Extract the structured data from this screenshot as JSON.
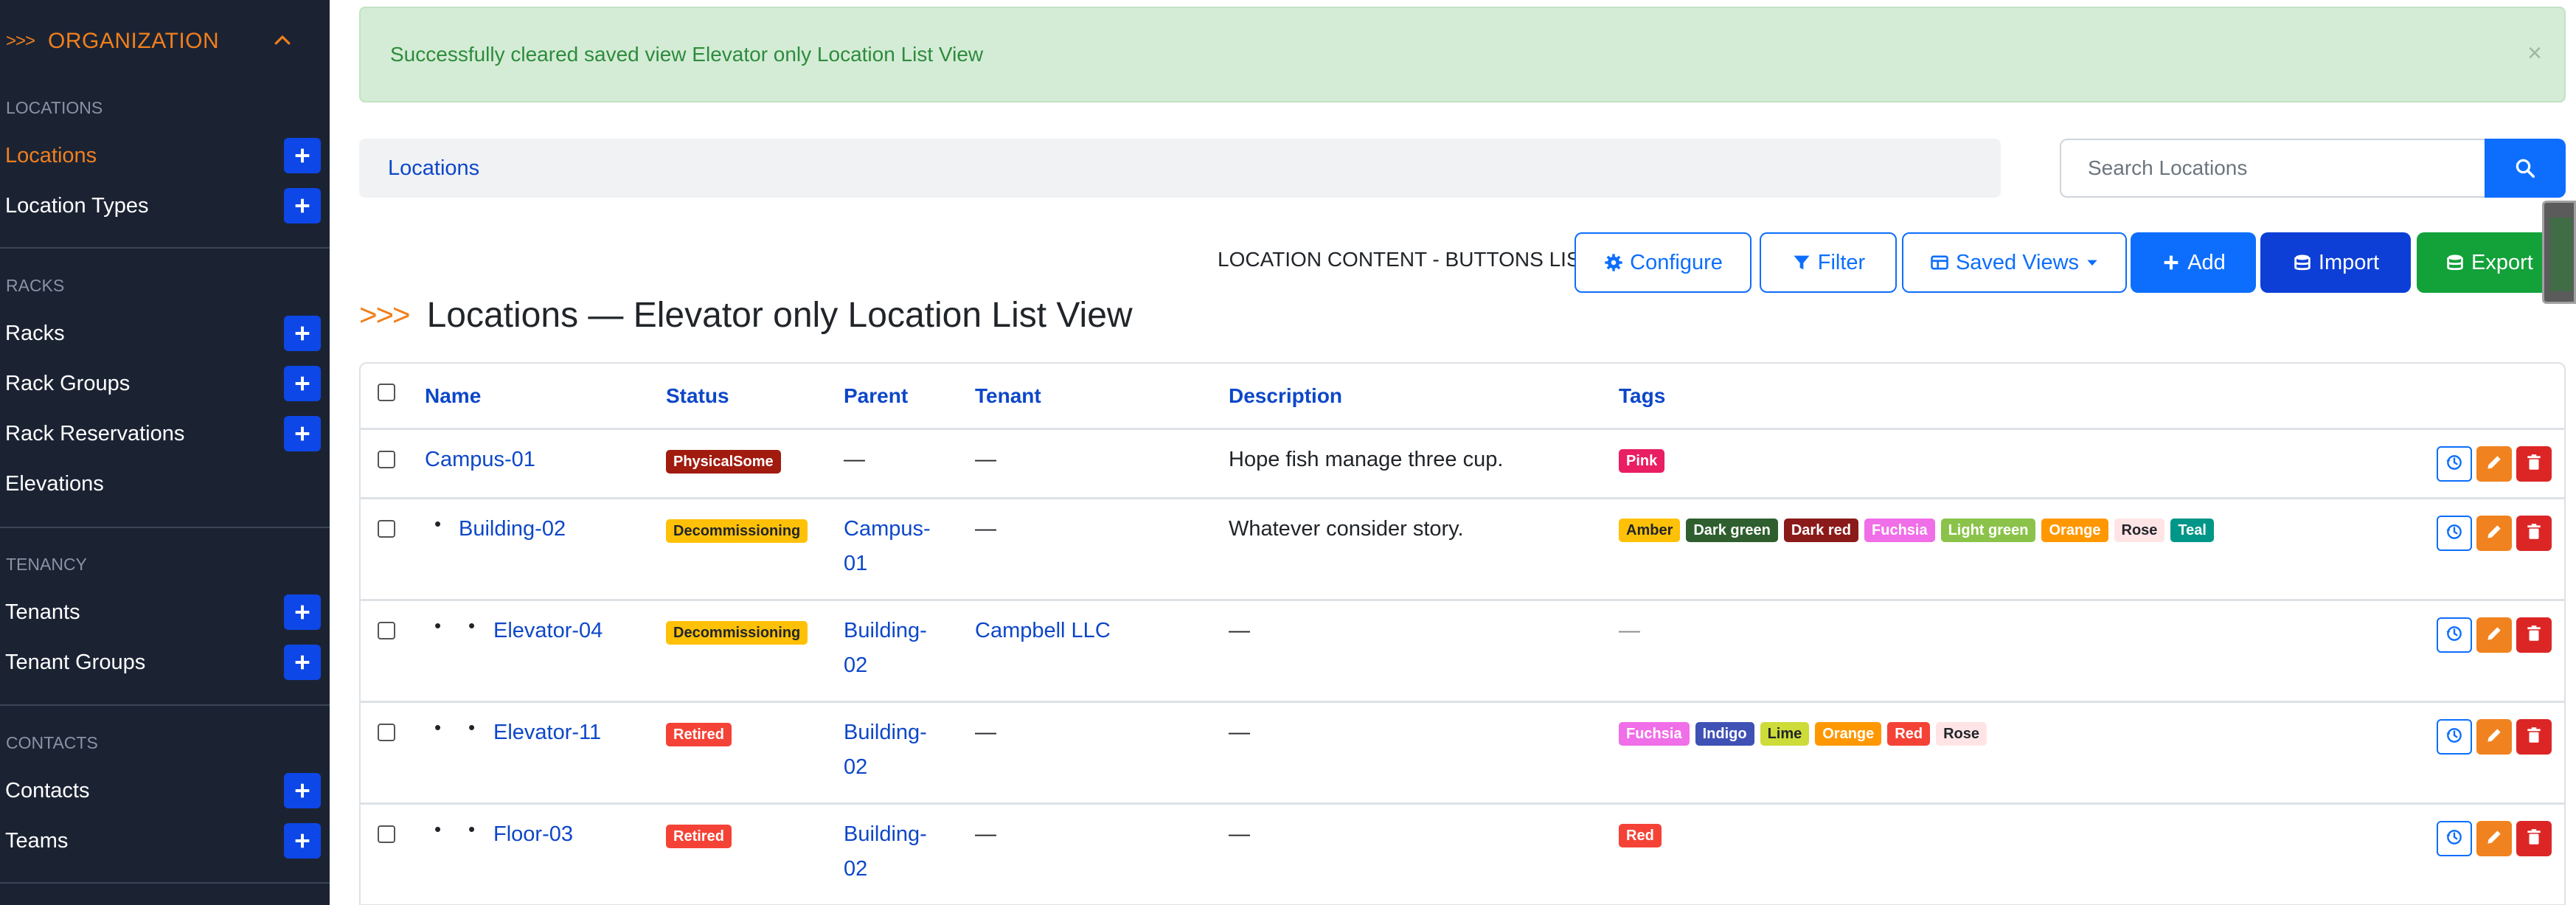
{
  "sidebar": {
    "header": {
      "arrows": ">>>",
      "title": "ORGANIZATION"
    },
    "sections": [
      {
        "label": "LOCATIONS",
        "items": [
          {
            "label": "Locations",
            "active": true,
            "add": true
          },
          {
            "label": "Location Types",
            "add": true
          }
        ]
      },
      {
        "label": "RACKS",
        "items": [
          {
            "label": "Racks",
            "add": true
          },
          {
            "label": "Rack Groups",
            "add": true
          },
          {
            "label": "Rack Reservations",
            "add": true
          },
          {
            "label": "Elevations",
            "add": false
          }
        ]
      },
      {
        "label": "TENANCY",
        "items": [
          {
            "label": "Tenants",
            "add": true
          },
          {
            "label": "Tenant Groups",
            "add": true
          }
        ]
      },
      {
        "label": "CONTACTS",
        "items": [
          {
            "label": "Contacts",
            "add": true
          },
          {
            "label": "Teams",
            "add": true
          }
        ]
      }
    ]
  },
  "alert": {
    "message": "Successfully cleared saved view Elevator only Location List View",
    "close": "×"
  },
  "breadcrumb": {
    "label": "Locations"
  },
  "search": {
    "placeholder": "Search Locations"
  },
  "toolbar": {
    "content_label": "LOCATION CONTENT - BUTTONS LIST",
    "configure": "Configure",
    "filter": "Filter",
    "saved_views": "Saved Views",
    "add": "Add",
    "import": "Import",
    "export": "Export"
  },
  "heading": {
    "arrows": ">>>",
    "title": "Locations — Elevator only Location List View"
  },
  "table": {
    "columns": [
      "Name",
      "Status",
      "Parent",
      "Tenant",
      "Description",
      "Tags"
    ],
    "rows": [
      {
        "depth": 0,
        "name": "Campus-01",
        "status": {
          "label": "PhysicalSome",
          "color": "#a11b0f"
        },
        "parent": [
          "—"
        ],
        "parent_link": false,
        "tenant": "—",
        "tenant_link": false,
        "description": "Hope fish manage three cup.",
        "tags": [
          {
            "label": "Pink",
            "color": "#e91e63",
            "text": "#ffffff"
          }
        ]
      },
      {
        "depth": 1,
        "name": "Building-02",
        "status": {
          "label": "Decommissioning",
          "color": "#ffc107",
          "text": "#212529"
        },
        "parent": [
          "Campus-",
          "01"
        ],
        "parent_link": true,
        "tenant": "—",
        "tenant_link": false,
        "description": "Whatever consider story.",
        "tags": [
          {
            "label": "Amber",
            "color": "#ffc107",
            "text": "#212529"
          },
          {
            "label": "Dark green",
            "color": "#2f5e2f",
            "text": "#ffffff"
          },
          {
            "label": "Dark red",
            "color": "#8b1a1a",
            "text": "#ffffff"
          },
          {
            "label": "Fuchsia",
            "color": "#f06ee8",
            "text": "#ffffff"
          },
          {
            "label": "Light green",
            "color": "#8bc34a",
            "text": "#ffffff"
          },
          {
            "label": "Orange",
            "color": "#ff9800",
            "text": "#ffffff"
          },
          {
            "label": "Rose",
            "color": "#ffe4e6",
            "text": "#212529"
          },
          {
            "label": "Teal",
            "color": "#009688",
            "text": "#ffffff"
          }
        ]
      },
      {
        "depth": 2,
        "name": "Elevator-04",
        "status": {
          "label": "Decommissioning",
          "color": "#ffc107",
          "text": "#212529"
        },
        "parent": [
          "Building-",
          "02"
        ],
        "parent_link": true,
        "tenant": "Campbell LLC",
        "tenant_link": true,
        "description": "—",
        "tags": [],
        "tags_empty": "—"
      },
      {
        "depth": 2,
        "name": "Elevator-11",
        "status": {
          "label": "Retired",
          "color": "#f44336"
        },
        "parent": [
          "Building-",
          "02"
        ],
        "parent_link": true,
        "tenant": "—",
        "tenant_link": false,
        "description": "—",
        "tags": [
          {
            "label": "Fuchsia",
            "color": "#f06ee8",
            "text": "#ffffff"
          },
          {
            "label": "Indigo",
            "color": "#3f51b5",
            "text": "#ffffff"
          },
          {
            "label": "Lime",
            "color": "#cddc39",
            "text": "#212529"
          },
          {
            "label": "Orange",
            "color": "#ff9800",
            "text": "#ffffff"
          },
          {
            "label": "Red",
            "color": "#f44336",
            "text": "#ffffff"
          },
          {
            "label": "Rose",
            "color": "#ffe4e6",
            "text": "#212529"
          }
        ]
      },
      {
        "depth": 2,
        "name": "Floor-03",
        "status": {
          "label": "Retired",
          "color": "#f44336"
        },
        "parent": [
          "Building-",
          "02"
        ],
        "parent_link": true,
        "tenant": "—",
        "tenant_link": false,
        "description": "—",
        "tags": [
          {
            "label": "Red",
            "color": "#f44336",
            "text": "#ffffff"
          }
        ]
      }
    ]
  },
  "colors": {
    "sidebar_bg": "#1b2333",
    "accent_orange": "#f07f1d",
    "primary_blue": "#0d6efd",
    "success_green": "#13a13a"
  }
}
